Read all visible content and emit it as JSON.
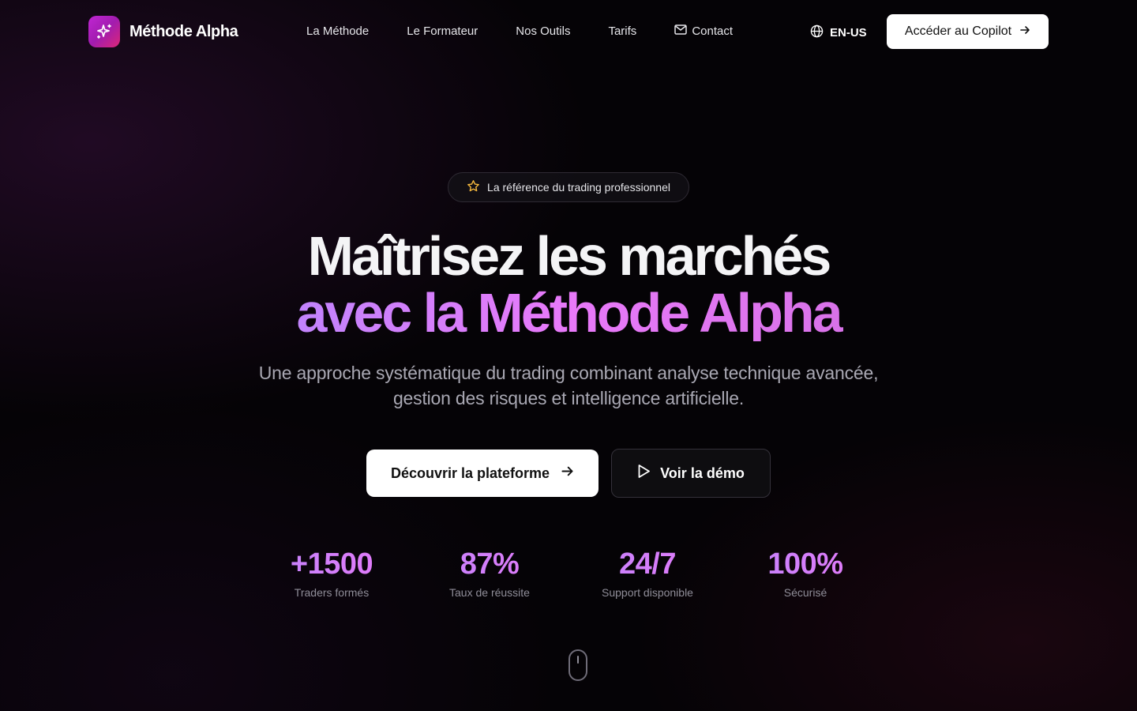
{
  "brand": {
    "name": "Méthode Alpha",
    "logo_icon": "sparkles-icon",
    "accent": "#c026d3"
  },
  "nav": {
    "links": [
      {
        "label": "La Méthode"
      },
      {
        "label": "Le Formateur"
      },
      {
        "label": "Nos Outils"
      },
      {
        "label": "Tarifs"
      },
      {
        "label": "Contact",
        "icon": "mail-icon"
      }
    ],
    "language": "EN-US",
    "cta": "Accéder au Copilot"
  },
  "hero": {
    "badge": "La référence du trading professionnel",
    "title_line1": "Maîtrisez les marchés",
    "title_line2": "avec la Méthode Alpha",
    "subtitle": "Une approche systématique du trading combinant analyse technique avancée, gestion des risques et intelligence artificielle.",
    "primary_cta": "Découvrir la plateforme",
    "secondary_cta": "Voir la démo"
  },
  "stats": [
    {
      "value": "+1500",
      "label": "Traders formés"
    },
    {
      "value": "87%",
      "label": "Taux de réussite"
    },
    {
      "value": "24/7",
      "label": "Support disponible"
    },
    {
      "value": "100%",
      "label": "Sécurisé"
    }
  ],
  "colors": {
    "background": "#050306",
    "gradient_start": "#a78bfa",
    "gradient_end": "#e879f9"
  }
}
